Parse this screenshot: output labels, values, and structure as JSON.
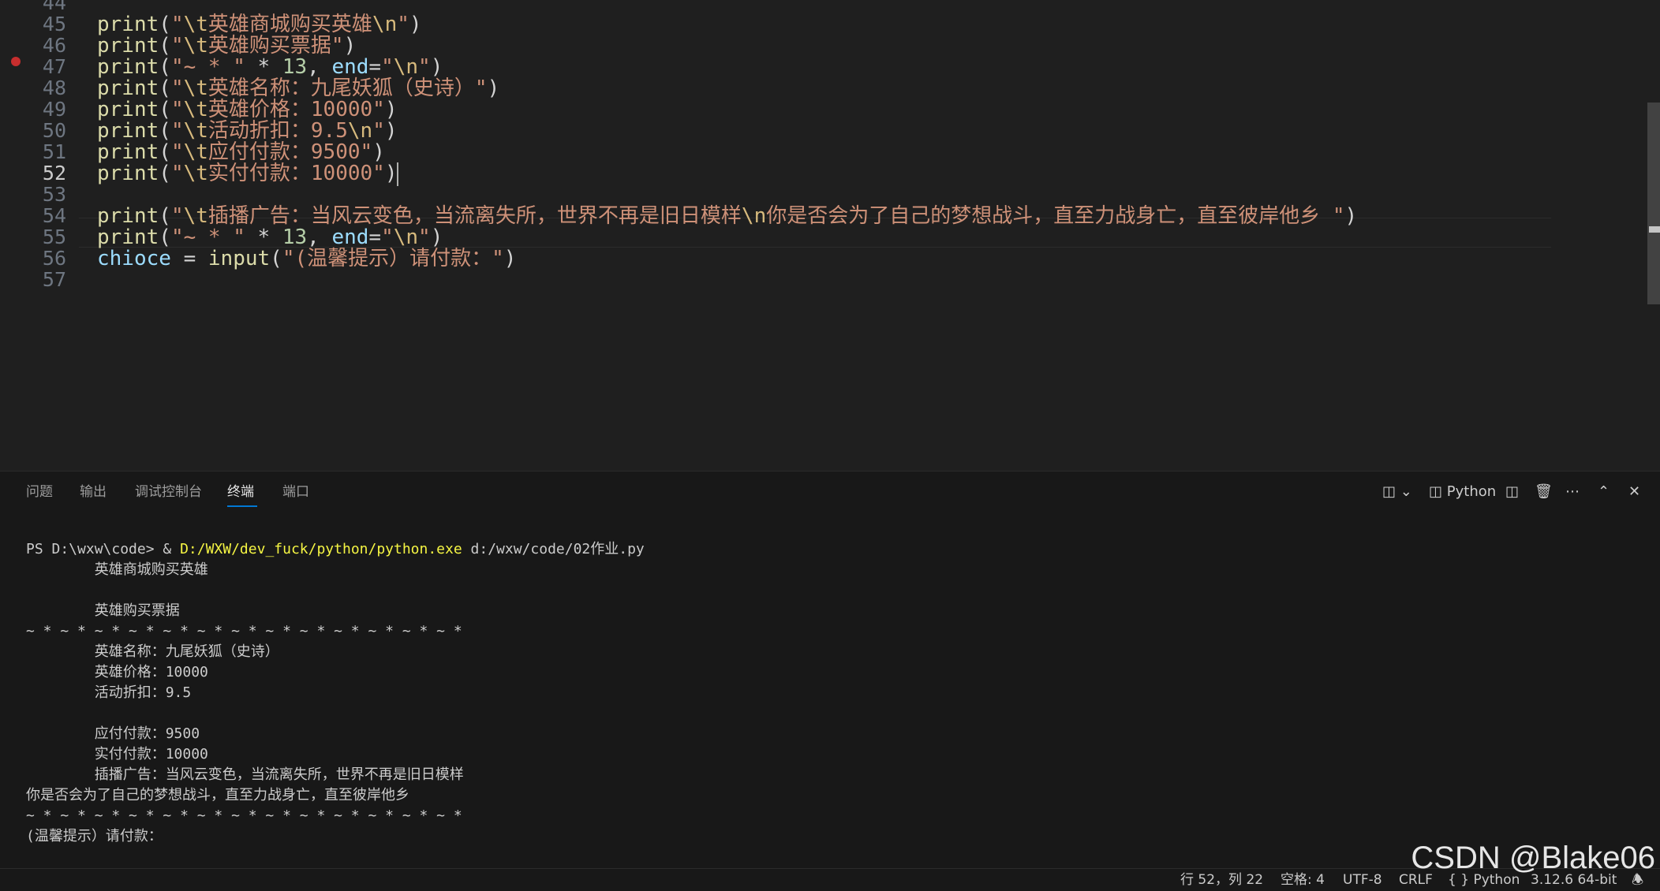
{
  "editor": {
    "active_line": "52",
    "lines": [
      {
        "num": "44",
        "code": ""
      },
      {
        "num": "45",
        "code": "print(\"\\t英雄商城购买英雄\\n\")"
      },
      {
        "num": "46",
        "code": "print(\"\\t英雄购买票据\")"
      },
      {
        "num": "47",
        "code": "print(\"~ * \" * 13, end=\"\\n\")"
      },
      {
        "num": "48",
        "code": "print(\"\\t英雄名称：九尾妖狐（史诗）\")"
      },
      {
        "num": "49",
        "code": "print(\"\\t英雄价格：10000\")"
      },
      {
        "num": "50",
        "code": "print(\"\\t活动折扣：9.5\\n\")"
      },
      {
        "num": "51",
        "code": "print(\"\\t应付付款：9500\")"
      },
      {
        "num": "52",
        "code": "print(\"\\t实付付款：10000\")"
      },
      {
        "num": "53",
        "code": ""
      },
      {
        "num": "54",
        "code": "print(\"\\t插播广告：当风云变色，当流离失所，世界不再是旧日模样\\n你是否会为了自己的梦想战斗，直至力战身亡，直至彼岸他乡 \")"
      },
      {
        "num": "55",
        "code": "print(\"~ * \" * 13, end=\"\\n\")"
      },
      {
        "num": "56",
        "code": "chioce = input(\"(温馨提示）请付款：\")"
      },
      {
        "num": "57",
        "code": ""
      }
    ]
  },
  "panel": {
    "tabs": [
      "问题",
      "输出",
      "调试控制台",
      "终端",
      "端口"
    ],
    "active_tab": "终端",
    "terminal_name": "Python",
    "terminal": {
      "prompt": "PS D:\\wxw\\code> & ",
      "exe": "D:/WXW/dev_fuck/python/python.exe",
      "args": " d:/wxw/code/02作业.py",
      "output": [
        "        英雄商城购买英雄",
        "",
        "        英雄购买票据",
        "~ * ~ * ~ * ~ * ~ * ~ * ~ * ~ * ~ * ~ * ~ * ~ * ~ * ",
        "        英雄名称：九尾妖狐（史诗）",
        "        英雄价格：10000",
        "        活动折扣：9.5",
        "",
        "        应付付款：9500",
        "        实付付款：10000",
        "        插播广告：当风云变色，当流离失所，世界不再是旧日模样",
        "你是否会为了自己的梦想战斗，直至力战身亡，直至彼岸他乡",
        "~ * ~ * ~ * ~ * ~ * ~ * ~ * ~ * ~ * ~ * ~ * ~ * ~ * ",
        "(温馨提示）请付款："
      ]
    }
  },
  "status": {
    "position": "行 52，列 22",
    "spaces": "空格: 4",
    "encoding": "UTF-8",
    "eol": "CRLF",
    "language": "{ } Python",
    "interpreter": "3.12.6 64-bit"
  },
  "watermark": "CSDN @Blake06",
  "colors": {
    "editor_bg": "#1f1f1f",
    "panel_bg": "#181818",
    "accent": "#0078d4",
    "string": "#ce9178",
    "function": "#dcdcaa",
    "number": "#b5cea8",
    "breakpoint": "#c72e2e"
  }
}
